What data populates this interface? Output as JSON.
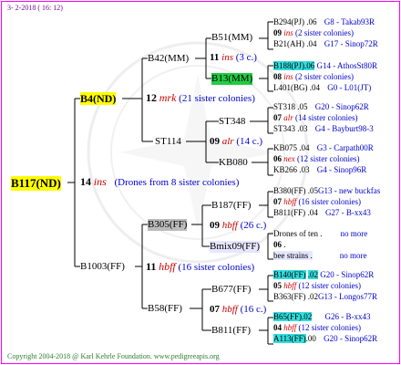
{
  "header": {
    "date": "3-  2-2018 ( 16: 12)"
  },
  "footer": {
    "copyright": "Copyright 2004-2018 @ Karl Kehrle Foundation.   www.pedigreeapis.org"
  },
  "colors": {
    "frame": "#ff00ff",
    "highlight_root": "#ffff00",
    "highlight_green": "#22cc44",
    "highlight_cyan": "#33dddd",
    "highlight_gray": "#bbbbbb"
  },
  "gen0": {
    "name": "B117(ND)"
  },
  "gen1": {
    "top": {
      "name": "B4(ND)"
    },
    "mid": {
      "num": "14",
      "ins": "ins",
      "note": "(Drones from 8 sister colonies)"
    },
    "bottom": {
      "name": "B1003(FF)"
    }
  },
  "gen2": {
    "a": {
      "name": "B42(MM)"
    },
    "a_mid": {
      "num": "12",
      "ins": "mrk",
      "note": "(21 sister colonies)"
    },
    "b": {
      "name": "ST114"
    },
    "c": {
      "name": "B305(FF)"
    },
    "c_mid": {
      "num": "11",
      "ins": "hbff",
      "note": "(16 sister colonies)"
    },
    "d": {
      "name": "B58(FF)"
    }
  },
  "gen3": {
    "a": {
      "name": "B51(MM)"
    },
    "a_mid": {
      "num": "11",
      "ins": "ins",
      "note": "(3 c.)"
    },
    "b": {
      "name": "B13(MM)"
    },
    "c": {
      "name": "ST348"
    },
    "c_mid": {
      "num": "09",
      "ins": "alr",
      "note": "(14 c.)"
    },
    "d": {
      "name": "KB080"
    },
    "e": {
      "name": "B187(FF)"
    },
    "e_mid": {
      "num": "09",
      "ins": "hbff",
      "note": "(26 c.)"
    },
    "f": {
      "name": "Bmix09(FF)"
    },
    "g": {
      "name": "B677(FF)"
    },
    "g_mid": {
      "num": "07",
      "ins": "hbff",
      "note": "(16 c.)"
    },
    "h": {
      "name": "B811(FF)"
    }
  },
  "gen4": [
    {
      "name": "B294(PJ)",
      "val": ".06",
      "info": "G8 - Takab93R"
    },
    {
      "num": "09",
      "ins": "ins",
      "note": "(2 sister colonies)"
    },
    {
      "name": "B21(AH)",
      "val": ".04",
      "info": "G17 - Sinop72R"
    },
    {
      "name": "B188(PJ)",
      "val": ".06",
      "info": "G14 - AthosSt80R"
    },
    {
      "num": "08",
      "ins": "ins",
      "note": "(2 sister colonies)"
    },
    {
      "name": "L401(BG)",
      "val": ".04",
      "info": "G0 - L01(JT)"
    },
    {
      "name": "ST318",
      "val": ".05",
      "info": "G20 - Sinop62R"
    },
    {
      "num": "07",
      "ins": "alr",
      "note": "(14 sister colonies)"
    },
    {
      "name": "ST343",
      "val": ".03",
      "info": "G4 - Bayburt98-3"
    },
    {
      "name": "KB075",
      "val": ".04",
      "info": "G3 - Carpath00R"
    },
    {
      "num": "06",
      "ins": "nex",
      "note": "(12 sister colonies)"
    },
    {
      "name": "KB266",
      "val": ".03",
      "info": "G4 - Sinop96R"
    },
    {
      "name": "B380(FF)",
      "val": ".05",
      "info": "G13 - new buckfas"
    },
    {
      "num": "07",
      "ins": "hbff",
      "note": "(16 sister colonies)"
    },
    {
      "name": "B811(FF)",
      "val": ".04",
      "info": "G27 - B-xx43"
    },
    {
      "name": "Drones of ten .",
      "val": "",
      "info": "no more"
    },
    {
      "num": "06",
      "ins": "",
      "note": "."
    },
    {
      "name": "bee strains .",
      "val": "",
      "info": "no more"
    },
    {
      "name": "B140(FF)",
      "val": ".02",
      "info": "G20 - Sinop62R"
    },
    {
      "num": "05",
      "ins": "hbff",
      "note": "(12 sister colonies)"
    },
    {
      "name": "B363(FF)",
      "val": ".02",
      "info": "G13 - Longos77R"
    },
    {
      "name": "B65(FF)",
      "val": ".02",
      "info": "G26 - B-xx43"
    },
    {
      "num": "04",
      "ins": "hbff",
      "note": "(12 sister colonies)"
    },
    {
      "name": "A113(FF)",
      "val": ".00",
      "info": "G20 - Sinop62R"
    }
  ]
}
